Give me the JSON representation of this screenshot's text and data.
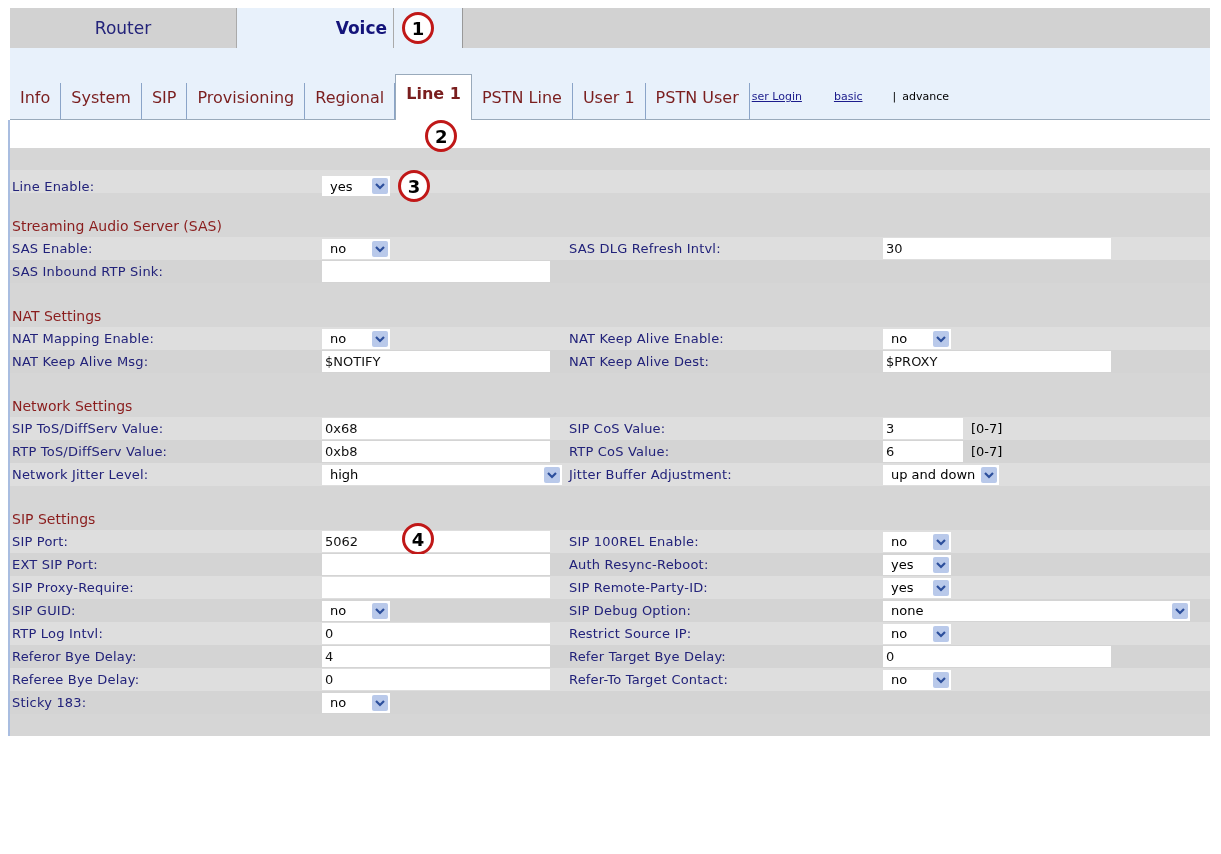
{
  "main_tabs": [
    {
      "label": "Router",
      "selected": false
    },
    {
      "label": "Voice",
      "selected": true,
      "callout": "1"
    }
  ],
  "sub_tabs": [
    {
      "label": "Info",
      "selected": false
    },
    {
      "label": "System",
      "selected": false
    },
    {
      "label": "SIP",
      "selected": false
    },
    {
      "label": "Provisioning",
      "selected": false
    },
    {
      "label": "Regional",
      "selected": false
    },
    {
      "label": "Line 1",
      "selected": true,
      "callout": "2"
    },
    {
      "label": "PSTN Line",
      "selected": false
    },
    {
      "label": "User 1",
      "selected": false
    },
    {
      "label": "PSTN User",
      "selected": false
    }
  ],
  "links": [
    {
      "label": "ser Login",
      "kind": "link"
    },
    {
      "label": "basic",
      "kind": "link"
    },
    {
      "label": "|",
      "kind": "separator"
    },
    {
      "label": "advance",
      "kind": "text"
    }
  ],
  "sections": [
    {
      "rows": [
        [
          {
            "label": "Line Enable:",
            "kind": "select",
            "value": "yes",
            "callout": "3"
          }
        ]
      ]
    },
    {
      "title": "Streaming Audio Server (SAS)",
      "rows": [
        [
          {
            "label": "SAS Enable:",
            "kind": "select",
            "value": "no"
          },
          {
            "label": "SAS DLG Refresh Intvl:",
            "kind": "text",
            "value": "30"
          }
        ],
        [
          {
            "label": "SAS Inbound RTP Sink:",
            "kind": "text"
          }
        ]
      ]
    },
    {
      "title": "NAT Settings",
      "rows": [
        [
          {
            "label": "NAT Mapping Enable:",
            "kind": "select",
            "value": "no"
          },
          {
            "label": "NAT Keep Alive Enable:",
            "kind": "select",
            "value": "no"
          }
        ],
        [
          {
            "label": "NAT Keep Alive Msg:",
            "kind": "text",
            "value": "$NOTIFY"
          },
          {
            "label": "NAT Keep Alive Dest:",
            "kind": "text",
            "value": "$PROXY"
          }
        ]
      ]
    },
    {
      "title": "Network Settings",
      "rows": [
        [
          {
            "label": "SIP ToS/DiffServ Value:",
            "kind": "text",
            "value": "0x68"
          },
          {
            "label": "SIP CoS Value:",
            "kind": "text-short",
            "value": "3",
            "hint": "[0-7]"
          }
        ],
        [
          {
            "label": "RTP ToS/DiffServ Value:",
            "kind": "text",
            "value": "0xb8"
          },
          {
            "label": "RTP CoS Value:",
            "kind": "text-short",
            "value": "6",
            "hint": "[0-7]"
          }
        ],
        [
          {
            "label": "Network Jitter Level:",
            "kind": "select-wide",
            "value": "high"
          },
          {
            "label": "Jitter Buffer Adjustment:",
            "kind": "select",
            "value": "up and down"
          }
        ]
      ]
    },
    {
      "title": "SIP Settings",
      "rows": [
        [
          {
            "label": "SIP Port:",
            "kind": "text",
            "value": "5062",
            "callout": "4"
          },
          {
            "label": "SIP 100REL Enable:",
            "kind": "select",
            "value": "no"
          }
        ],
        [
          {
            "label": "EXT SIP Port:",
            "kind": "text"
          },
          {
            "label": "Auth Resync-Reboot:",
            "kind": "select",
            "value": "yes"
          }
        ],
        [
          {
            "label": "SIP Proxy-Require:",
            "kind": "text"
          },
          {
            "label": "SIP Remote-Party-ID:",
            "kind": "select",
            "value": "yes"
          }
        ],
        [
          {
            "label": "SIP GUID:",
            "kind": "select",
            "value": "no"
          },
          {
            "label": "SIP Debug Option:",
            "kind": "select-full",
            "value": "none"
          }
        ],
        [
          {
            "label": "RTP Log Intvl:",
            "kind": "text",
            "value": "0"
          },
          {
            "label": "Restrict Source IP:",
            "kind": "select",
            "value": "no"
          }
        ],
        [
          {
            "label": "Referor Bye Delay:",
            "kind": "text",
            "value": "4"
          },
          {
            "label": "Refer Target Bye Delay:",
            "kind": "text",
            "value": "0"
          }
        ],
        [
          {
            "label": "Referee Bye Delay:",
            "kind": "text",
            "value": "0"
          },
          {
            "label": "Refer-To Target Contact:",
            "kind": "select",
            "value": "no"
          }
        ],
        [
          {
            "label": "Sticky 183:",
            "kind": "select",
            "value": "no"
          }
        ]
      ]
    }
  ]
}
